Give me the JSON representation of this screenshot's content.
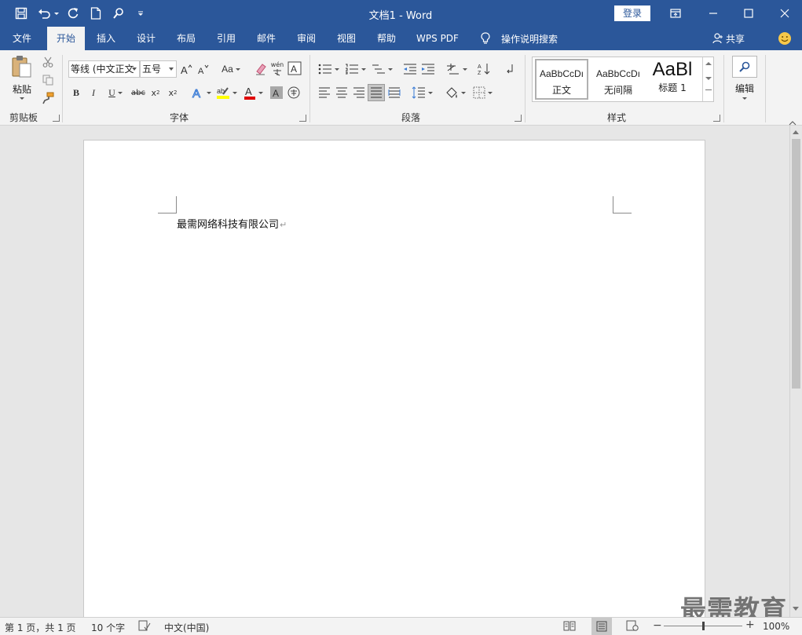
{
  "window": {
    "title": "文档1  -  Word",
    "login_label": "登录"
  },
  "menu": {
    "tabs": [
      "文件",
      "开始",
      "插入",
      "设计",
      "布局",
      "引用",
      "邮件",
      "审阅",
      "视图",
      "帮助",
      "WPS PDF"
    ],
    "active_tab": "开始",
    "tell_me": "操作说明搜索",
    "share": "共享"
  },
  "ribbon": {
    "clipboard": {
      "label": "剪贴板",
      "paste_label": "粘贴"
    },
    "font": {
      "label": "字体",
      "font_name": "等线 (中文正文",
      "font_size": "五号",
      "change_case": "Aa",
      "phonetic": "wén"
    },
    "paragraph": {
      "label": "段落"
    },
    "styles": {
      "label": "样式",
      "items": [
        {
          "preview": "AaBbCcDı",
          "name": "正文"
        },
        {
          "preview": "AaBbCcDı",
          "name": "无间隔"
        },
        {
          "preview": "AaBl",
          "name": "标题 1"
        }
      ]
    },
    "editing": {
      "label": "编辑"
    }
  },
  "document": {
    "body_text": "最需网络科技有限公司"
  },
  "status": {
    "page": "第 1 页，共 1 页",
    "words": "10 个字",
    "language": "中文(中国)",
    "zoom": "100%",
    "zoom_level": 1.0
  },
  "watermark": "最需教育",
  "colors": {
    "accent": "#2b579a",
    "highlight": "#ffff00",
    "font_color": "#e00000"
  }
}
